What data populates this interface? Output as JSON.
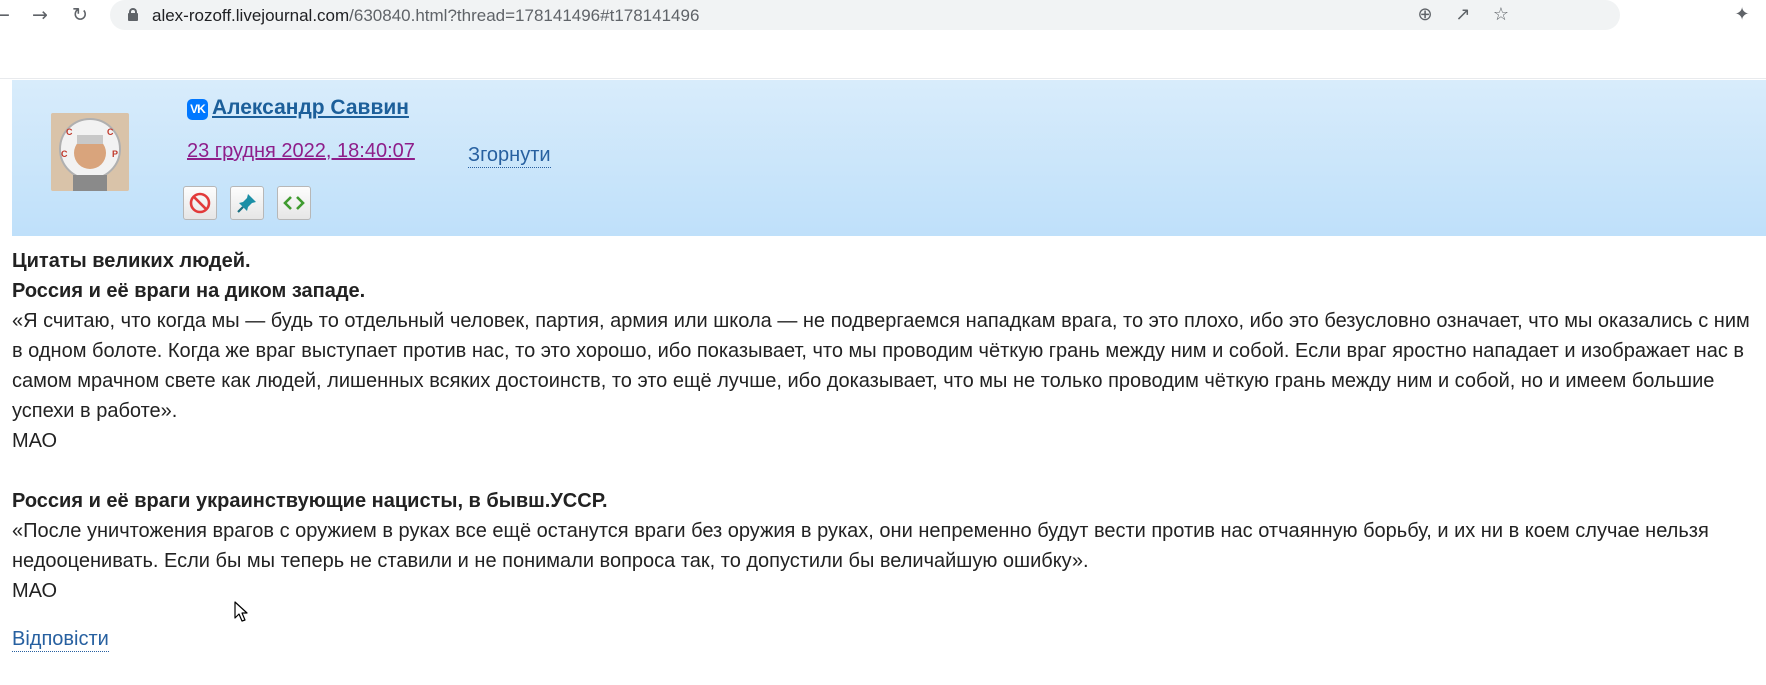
{
  "browser": {
    "url_host": "alex-rozoff.livejournal.com",
    "url_path": "/630840.html?thread=178141496#t178141496",
    "icons": [
      "back-icon",
      "forward-icon",
      "reload-icon",
      "lock-icon",
      "zoom-icon",
      "share-icon",
      "star-icon",
      "extensions-icon"
    ]
  },
  "comment": {
    "author": "Александр Саввин",
    "author_badge": "VK",
    "date": "23 грудня 2022, 18:40:07",
    "collapse_label": "Згорнути",
    "reply_label": "Відповісти",
    "body": {
      "heading1": "Цитаты великих людей.",
      "heading2": "Россия и её враги на диком западе.",
      "quote1": "«Я считаю, что когда мы — будь то отдельный человек, партия, армия или школа — не подвергаемся нападкам врага, то это плохо, ибо это безусловно означает, что мы оказались с ним в одном болоте. Когда же враг выступает против нас, то это хорошо, ибо показывает, что мы проводим чёткую грань между ним и собой. Если враг яростно нападает и изображает нас в самом мрачном свете как людей, лишенных всяких достоинств, то это ещё лучше, ибо доказывает, что мы не только проводим чёткую грань между ним и собой, но и имеем большие успехи в работе».",
      "sign1": "МАО",
      "heading3": "Россия и её враги украинствующие нацисты, в бывш.УССР.",
      "quote2": "«После уничтожения врагов с оружием в руках все ещё останутся враги без оружия в руках, они непременно будут вести против нас отчаянную борьбу, и их ни в коем случае нельзя недооценивать. Если бы мы теперь не ставили и не понимали вопроса так, то допустили бы величайшую ошибку».",
      "sign2": "МАО"
    },
    "tool_icons": [
      "block-icon",
      "pin-icon",
      "code-icon"
    ]
  },
  "colors": {
    "header_bg": "#c4e3fb",
    "author_link": "#1c5f9a",
    "date_link": "#8e1e8a",
    "action_link": "#2760a0"
  }
}
